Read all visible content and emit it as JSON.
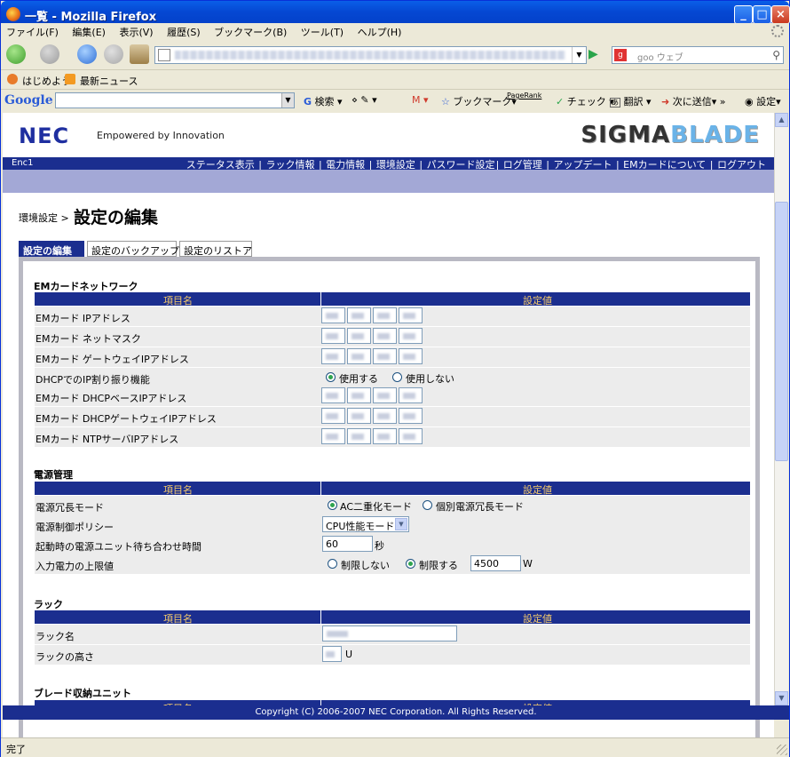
{
  "window": {
    "title": "一覧 - Mozilla Firefox"
  },
  "menu": [
    "ファイル(F)",
    "編集(E)",
    "表示(V)",
    "履歴(S)",
    "ブックマーク(B)",
    "ツール(T)",
    "ヘルプ(H)"
  ],
  "search": {
    "placeholder": "goo ウェブ"
  },
  "bookmarks": [
    "はじめよう",
    "最新ニュース"
  ],
  "google_toolbar": {
    "logo": "Google",
    "items": [
      "検索",
      "ブックマーク",
      "PageRank",
      "チェック",
      "翻訳",
      "次に送信",
      "»",
      "設定"
    ]
  },
  "header": {
    "brand": "NEC",
    "tagline": "Empowered by Innovation",
    "product_a": "SIGMA",
    "product_b": "BLADE",
    "product_c": "",
    "enclosure": "Enc1",
    "nav": [
      "ステータス表示",
      "ラック情報",
      "電力情報",
      "環境設定",
      "パスワード設定",
      "ログ管理",
      "アップデート",
      "EMカードについて",
      "ログアウト"
    ]
  },
  "breadcrumb": "環境設定 >",
  "page_title": "設定の編集",
  "tabs": [
    "設定の編集",
    "設定のバックアップ",
    "設定のリストア"
  ],
  "table_headers": {
    "item": "項目名",
    "value": "設定値"
  },
  "network": {
    "title": "EMカードネットワーク",
    "rows": [
      "EMカード IPアドレス",
      "EMカード ネットマスク",
      "EMカード ゲートウェイIPアドレス",
      "DHCPでのIP割り振り機能",
      "EMカード DHCPベースIPアドレス",
      "EMカード DHCPゲートウェイIPアドレス",
      "EMカード NTPサーバIPアドレス"
    ],
    "dhcp_on": "使用する",
    "dhcp_off": "使用しない"
  },
  "power": {
    "title": "電源管理",
    "rows": [
      "電源冗長モード",
      "電源制御ポリシー",
      "起動時の電源ユニット待ち合わせ時間",
      "入力電力の上限値"
    ],
    "mode_ac": "AC二重化モード",
    "mode_individual": "個別電源冗長モード",
    "policy": "CPU性能モード",
    "wait_value": "60",
    "wait_unit": "秒",
    "limit_off": "制限しない",
    "limit_on": "制限する",
    "limit_value": "4500",
    "limit_unit": "W"
  },
  "rack": {
    "title": "ラック",
    "rows": [
      "ラック名",
      "ラックの高さ"
    ],
    "height_unit": "U"
  },
  "blade": {
    "title": "ブレード収納ユニット"
  },
  "footer": "Copyright (C) 2006-2007 NEC Corporation. All Rights Reserved.",
  "status": "完了"
}
